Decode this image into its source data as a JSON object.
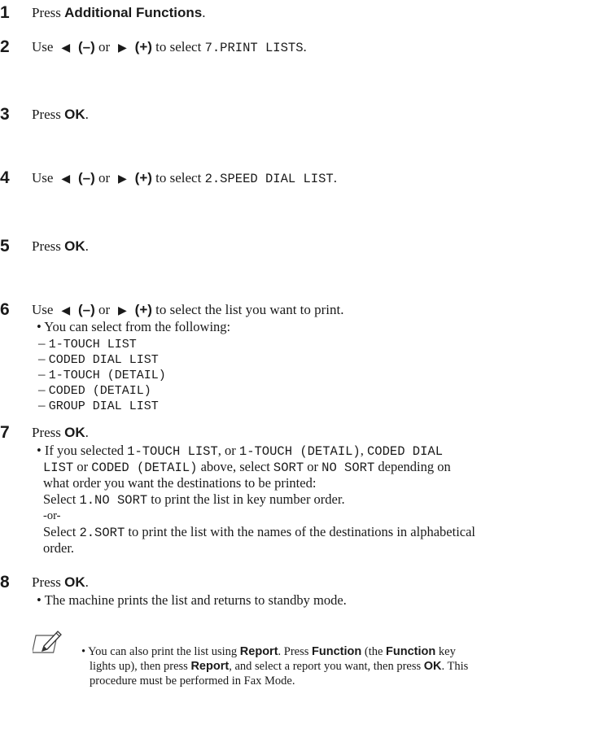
{
  "steps": [
    {
      "num": "1",
      "press": "Press ",
      "bold": "Additional Functions",
      "end": "."
    },
    {
      "num": "2",
      "use": "Use ",
      "minus": "(–)",
      "or": " or ",
      "plus": "(+)",
      "to": " to select ",
      "mono": "7.PRINT LISTS",
      "end": "."
    },
    {
      "num": "3",
      "press": "Press ",
      "bold": "OK",
      "end": "."
    },
    {
      "num": "4",
      "use": "Use ",
      "minus": "(–)",
      "or": " or ",
      "plus": "(+)",
      "to": " to select ",
      "mono": "2.SPEED DIAL LIST",
      "end": "."
    },
    {
      "num": "5",
      "press": "Press ",
      "bold": "OK",
      "end": "."
    },
    {
      "num": "6",
      "use": "Use ",
      "minus": "(–)",
      "or": " or ",
      "plus": "(+)",
      "rest": " to select the list you want to print."
    },
    {
      "num": "7",
      "press": "Press ",
      "bold": "OK",
      "end": "."
    },
    {
      "num": "8",
      "press": "Press ",
      "bold": "OK",
      "end": "."
    }
  ],
  "step6_bullet": "• You can select from the following:",
  "step6_items": [
    "1-TOUCH LIST",
    "CODED DIAL LIST",
    "1-TOUCH (DETAIL)",
    "CODED (DETAIL)",
    "GROUP DIAL LIST"
  ],
  "step7": {
    "l1a": "• If you selected ",
    "l1m1": "1-TOUCH LIST",
    "l1b": ", or ",
    "l1m2": "1-TOUCH (DETAIL)",
    "l1c": ", ",
    "l1m3": "CODED DIAL",
    "l2m1": "LIST",
    "l2a": " or ",
    "l2m2": "CODED (DETAIL)",
    "l2b": " above, select ",
    "l2m3": "SORT",
    "l2c": " or ",
    "l2m4": "NO SORT",
    "l2d": " depending on",
    "l3": "what order you want the destinations to be printed:",
    "l4a": "Select ",
    "l4m": "1.NO SORT",
    "l4b": " to print the list in key number order.",
    "l5": "-or-",
    "l6a": "Select ",
    "l6m": "2.SORT",
    "l6b": " to print the list with the names of the destinations in alphabetical",
    "l7": "order."
  },
  "step8_bullet": "• The machine prints the list and returns to standby mode.",
  "note": {
    "l1a": "• You can also print the list using ",
    "l1b": "Report",
    "l1c": ". Press ",
    "l1d": "Function",
    "l1e": " (the ",
    "l1f": "Function",
    "l1g": " key",
    "l2a": "lights up), then press ",
    "l2b": "Report",
    "l2c": ", and select a report you want, then press ",
    "l2d": "OK",
    "l2e": ". This",
    "l3": "procedure must be performed in Fax Mode."
  },
  "icons": {
    "left_arrow": "left-triangle",
    "right_arrow": "right-triangle",
    "note": "pencil-note-icon"
  }
}
